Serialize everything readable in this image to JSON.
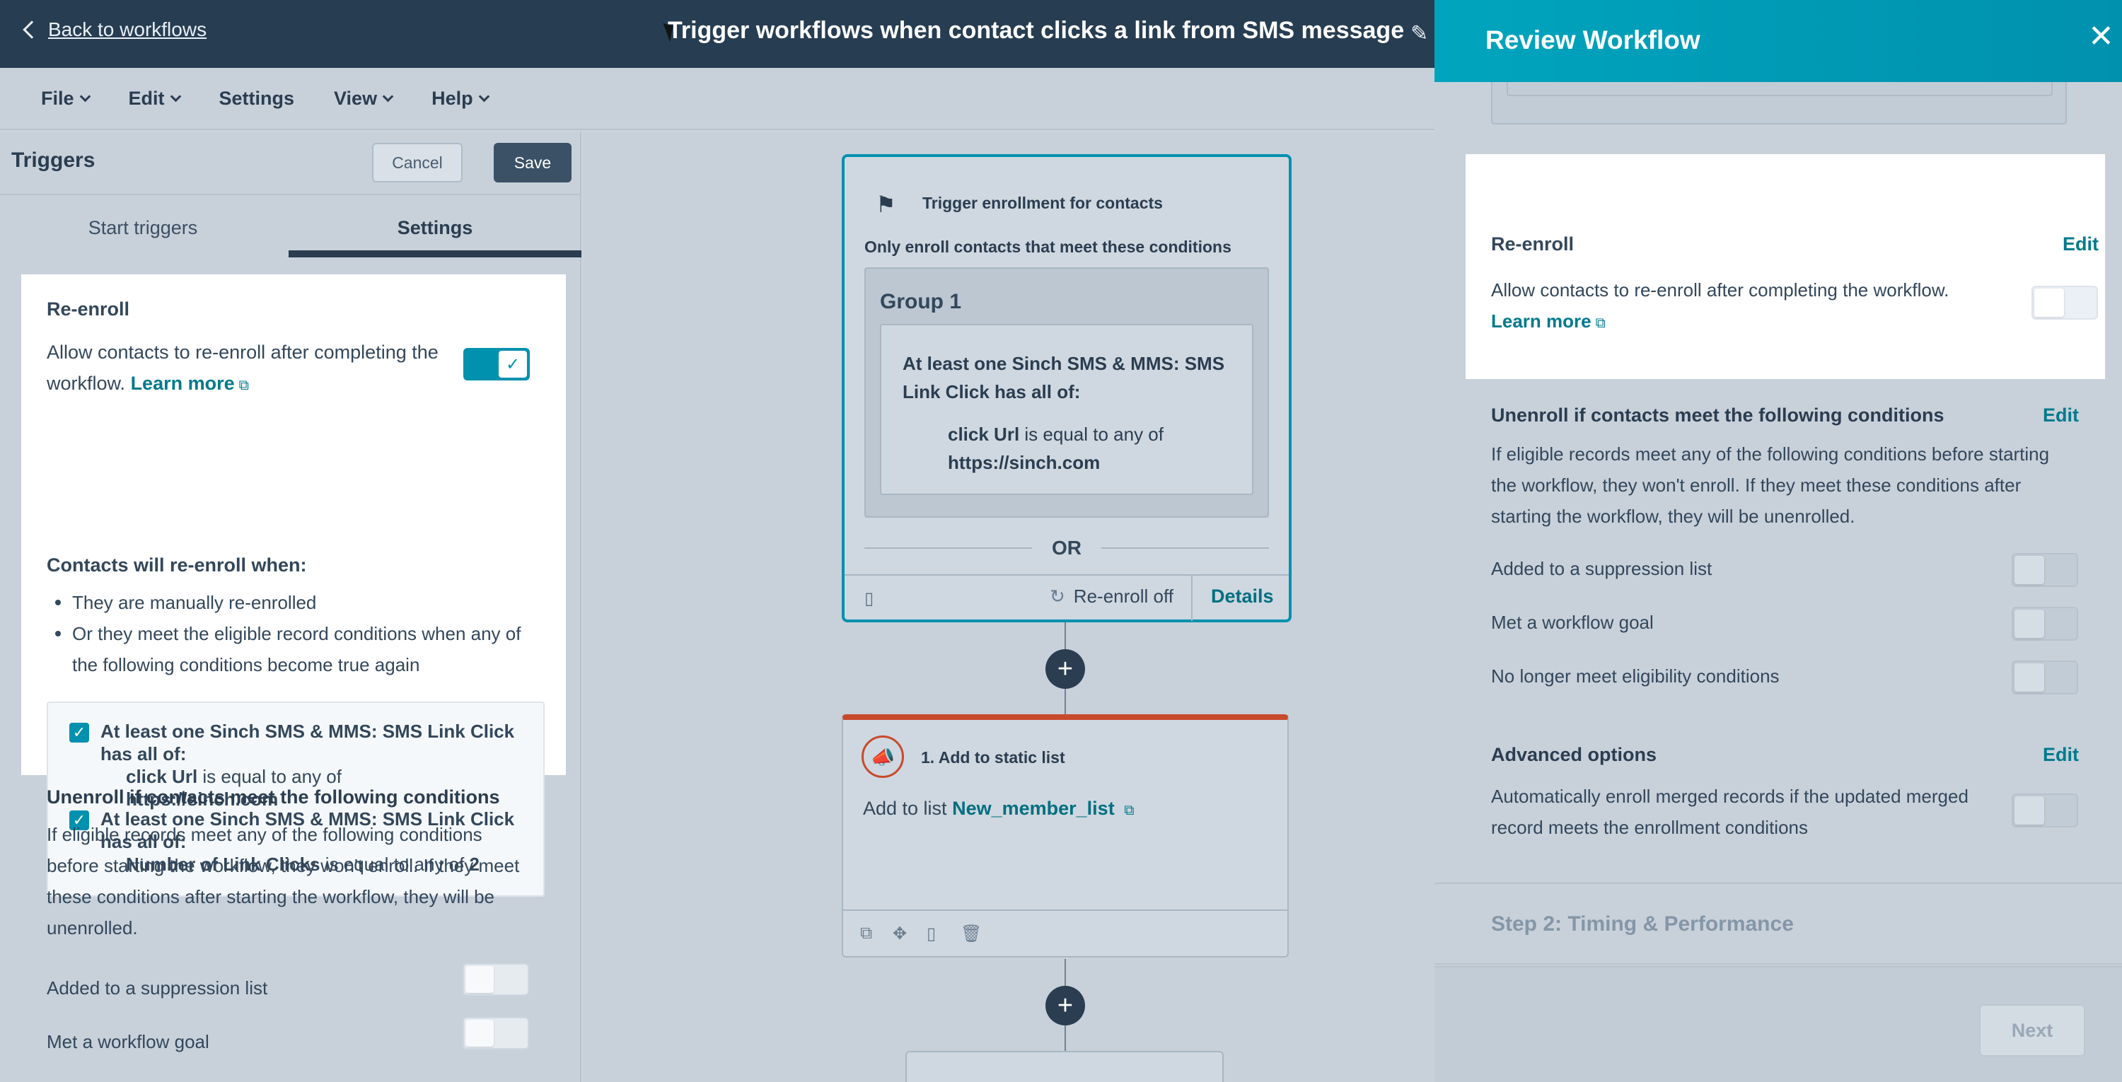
{
  "topbar": {
    "back_label": "Back to workflows",
    "workflow_title": "Trigger workflows when contact clicks a link from SMS message"
  },
  "menubar": {
    "items": [
      "File",
      "Edit",
      "Settings",
      "View",
      "Help"
    ]
  },
  "left_panel": {
    "title": "Triggers",
    "cancel_label": "Cancel",
    "save_label": "Save",
    "tabs": [
      "Start triggers",
      "Settings"
    ],
    "active_tab": "Settings",
    "reenroll": {
      "label": "Re-enroll",
      "desc": "Allow contacts to re-enroll after completing the workflow.",
      "learn_more": "Learn more",
      "enabled": true,
      "when_title": "Contacts will re-enroll when:",
      "bullets": [
        "They are manually re-enrolled",
        "Or they meet the eligible record conditions when any of the following conditions become true again"
      ],
      "conditions": [
        {
          "head": "At least one Sinch SMS & MMS: SMS Link Click has all of:",
          "prop": "click Url",
          "op": "is equal to any of",
          "value": "https://sinch.com"
        },
        {
          "head": "At least one Sinch SMS & MMS: SMS Link Click has all of:",
          "prop": "Number of Link Clicks",
          "op": "is equal to any of",
          "value": "2"
        }
      ]
    },
    "unenroll": {
      "title": "Unenroll if contacts meet the following conditions",
      "desc": "If eligible records meet any of the following conditions before starting the workflow, they won't enroll. If they meet these conditions after starting the workflow, they will be unenrolled.",
      "options": [
        "Added to a suppression list",
        "Met a workflow goal"
      ]
    }
  },
  "canvas": {
    "trigger_card": {
      "title": "Trigger enrollment for contacts",
      "subtitle": "Only enroll contacts that meet these conditions",
      "group_title": "Group 1",
      "condition_head": "At least one Sinch SMS & MMS: SMS Link Click has all of:",
      "condition_prop": "click Url",
      "condition_op": "is equal to any of",
      "condition_value": "https://sinch.com",
      "or_label": "OR",
      "reenroll_status": "Re-enroll off",
      "details_label": "Details"
    },
    "action_card": {
      "title": "1. Add to static list",
      "text_prefix": "Add to list",
      "list_name": "New_member_list"
    }
  },
  "review_panel": {
    "title": "Review Workflow",
    "reenroll": {
      "title": "Re-enroll",
      "edit": "Edit",
      "desc": "Allow contacts to re-enroll after completing the workflow.",
      "learn_more": "Learn more",
      "enabled": false
    },
    "unenroll": {
      "title": "Unenroll if contacts meet the following conditions",
      "edit": "Edit",
      "desc": "If eligible records meet any of the following conditions before starting the workflow, they won't enroll. If they meet these conditions after starting the workflow, they will be unenrolled.",
      "options": [
        {
          "label": "Added to a suppression list",
          "enabled": false
        },
        {
          "label": "Met a workflow goal",
          "enabled": false
        },
        {
          "label": "No longer meet eligibility conditions",
          "enabled": false
        }
      ]
    },
    "advanced": {
      "title": "Advanced options",
      "edit": "Edit",
      "desc": "Automatically enroll merged records if the updated merged record meets the enrollment conditions",
      "enabled": false
    },
    "step2_label": "Step 2: Timing & Performance",
    "next_label": "Next"
  }
}
